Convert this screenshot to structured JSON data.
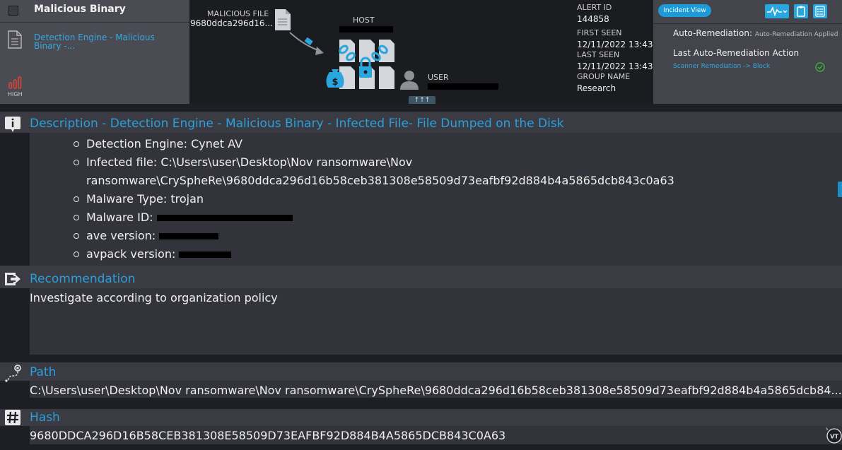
{
  "header": {
    "alert_title": "Malicious Binary",
    "engine_link": "Detection Engine - Malicious Binary -...",
    "severity": "HIGH",
    "malicious_file_label": "MALICIOUS FILE",
    "malicious_file_value": "9680ddca296d16...",
    "host_label": "HOST",
    "user_label": "USER",
    "expand_label": "↑↑↑"
  },
  "info": {
    "alert_id_label": "ALERT ID",
    "alert_id": "144858",
    "first_seen_label": "FIRST SEEN",
    "first_seen": "12/11/2022 13:43",
    "last_seen_label": "LAST SEEN",
    "last_seen": "12/11/2022 13:43",
    "group_name_label": "GROUP NAME",
    "group_name": "Research"
  },
  "remediation": {
    "incident_view": "Incident View",
    "auto_label": "Auto-Remediation:",
    "auto_value": "Auto-Remediation Applied",
    "last_action_label": "Last Auto-Remediation Action",
    "last_action_link": "Scanner Remediation -> Block"
  },
  "description": {
    "title": "Description - Detection Engine - Malicious Binary - Infected File- File Dumped on the Disk",
    "items": [
      "Detection Engine: Cynet AV",
      "Infected file: C:\\Users\\user\\Desktop\\Nov ransomware\\Nov",
      "ransomware\\CrySpheRe\\9680ddca296d16b58ceb381308e58509d73eafbf92d884b4a5865dcb843c0a63",
      "Malware Type: trojan",
      "Malware ID:",
      "ave version:",
      "avpack version:"
    ]
  },
  "recommendation": {
    "title": "Recommendation",
    "text": "Investigate according to organization policy"
  },
  "path": {
    "title": "Path",
    "text": "C:\\Users\\user\\Desktop\\Nov ransomware\\Nov ransomware\\CrySpheRe\\9680ddca296d16b58ceb381308e58509d73eafbf92d884b4a5865dcb84..."
  },
  "hash": {
    "title": "Hash",
    "text": "9680DDCA296D16B58CEB381308E58509D73EAFBF92D884B4A5865DCB843C0A63"
  },
  "colors": {
    "accent": "#2b9fdc",
    "severity_high": "#e0453a",
    "ok": "#3fae3a"
  }
}
